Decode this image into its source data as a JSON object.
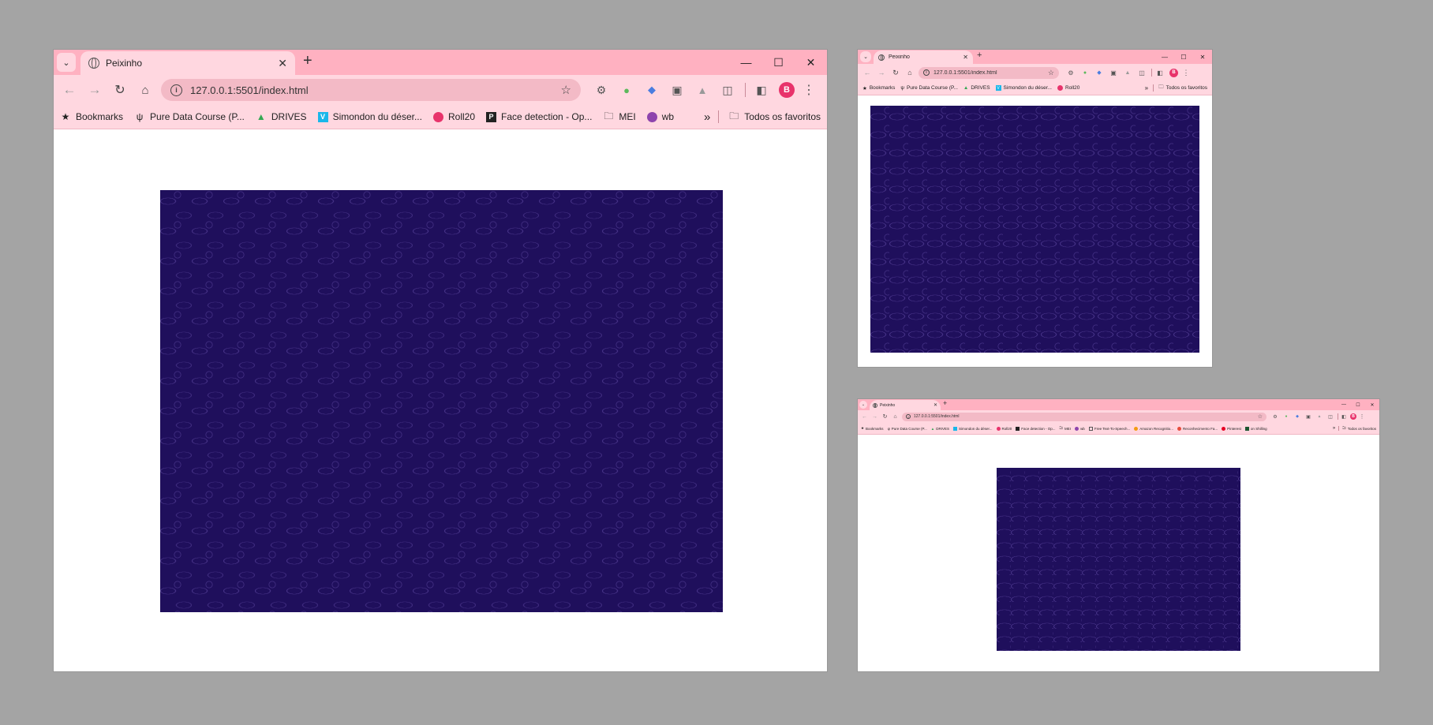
{
  "colors": {
    "desktop": "#a4a4a4",
    "tab_strip": "#ffb1c1",
    "toolbar": "#ffd7e0",
    "omnibox": "#f3bac6",
    "avatar": "#e8336b",
    "sea": "#1f0f5c",
    "waves": "#5a46a0"
  },
  "browser": {
    "tab_title": "Peixinho",
    "url": "127.0.0.1:5501/index.html",
    "profile_initial": "B",
    "icons": {
      "back": "arrow-left-icon",
      "forward": "arrow-right-icon",
      "reload": "reload-icon",
      "home": "home-icon",
      "site_info": "info-icon",
      "bookmark": "star-icon",
      "menu": "kebab-menu-icon"
    }
  },
  "window_large": {
    "bookmarks": [
      {
        "label": "Bookmarks",
        "icon": "star-icon"
      },
      {
        "label": "Pure Data Course (P...",
        "icon": "pd-icon"
      },
      {
        "label": "DRIVES",
        "icon": "drive-icon"
      },
      {
        "label": "Simondon du déser...",
        "icon": "vimeo-icon"
      },
      {
        "label": "Roll20",
        "icon": "roll20-icon"
      },
      {
        "label": "Face detection - Op...",
        "icon": "p-icon"
      },
      {
        "label": "MEI",
        "icon": "folder-icon"
      },
      {
        "label": "wb",
        "icon": "wb-icon"
      }
    ],
    "more_label": "»",
    "all_bookmarks": "Todos os favoritos"
  },
  "window_medium": {
    "bookmarks": [
      {
        "label": "Bookmarks",
        "icon": "star-icon"
      },
      {
        "label": "Pure Data Course (P...",
        "icon": "pd-icon"
      },
      {
        "label": "DRIVES",
        "icon": "drive-icon"
      },
      {
        "label": "Simondon du déser...",
        "icon": "vimeo-icon"
      },
      {
        "label": "Roll20",
        "icon": "roll20-icon"
      }
    ],
    "more_label": "»",
    "all_bookmarks": "Todos os favoritos"
  },
  "window_small": {
    "bookmarks": [
      {
        "label": "Bookmarks",
        "icon": "star-icon"
      },
      {
        "label": "Pure Data Course (P...",
        "icon": "pd-icon"
      },
      {
        "label": "DRIVES",
        "icon": "drive-icon"
      },
      {
        "label": "Simondon du déser...",
        "icon": "vimeo-icon"
      },
      {
        "label": "Roll20",
        "icon": "roll20-icon"
      },
      {
        "label": "Face detection - Op...",
        "icon": "p-icon"
      },
      {
        "label": "MEI",
        "icon": "folder-icon"
      },
      {
        "label": "wb",
        "icon": "wb-icon"
      },
      {
        "label": "Free Text-To-Speech...",
        "icon": "tts-icon"
      },
      {
        "label": "Amazon Recognitio...",
        "icon": "aws-icon"
      },
      {
        "label": "Reconhecimento Fa...",
        "icon": "face-icon"
      },
      {
        "label": "Pinterest",
        "icon": "pinterest-icon"
      },
      {
        "label": "on Shilling",
        "icon": "shilling-icon"
      }
    ],
    "more_label": "»",
    "all_bookmarks": "Todos os favoritos"
  }
}
